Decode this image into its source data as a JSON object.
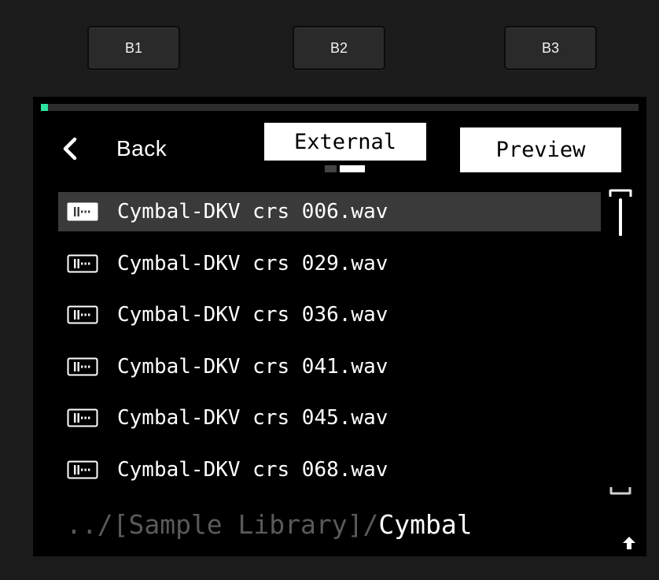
{
  "hardware_buttons": [
    {
      "label": "B1"
    },
    {
      "label": "B2"
    },
    {
      "label": "B3"
    }
  ],
  "screen": {
    "progress": 0.012,
    "accent_color": "#2ee3a0",
    "back": {
      "label": "Back",
      "icon": "chevron-left-icon"
    },
    "tab": {
      "label": "External"
    },
    "page_indicator": {
      "pages": 2,
      "current": 2
    },
    "preview": {
      "label": "Preview"
    },
    "files": [
      {
        "name": "Cymbal-DKV crs 006.wav",
        "selected": true,
        "icon": "audio-file-icon"
      },
      {
        "name": "Cymbal-DKV crs 029.wav",
        "selected": false,
        "icon": "audio-file-icon"
      },
      {
        "name": "Cymbal-DKV crs 036.wav",
        "selected": false,
        "icon": "audio-file-icon"
      },
      {
        "name": "Cymbal-DKV crs 041.wav",
        "selected": false,
        "icon": "audio-file-icon"
      },
      {
        "name": "Cymbal-DKV crs 045.wav",
        "selected": false,
        "icon": "audio-file-icon"
      },
      {
        "name": "Cymbal-DKV crs 068.wav",
        "selected": false,
        "icon": "audio-file-icon"
      }
    ],
    "path": {
      "prefix": "../[Sample Library]/",
      "current": "Cymbal"
    },
    "up_icon": "arrow-up-icon"
  }
}
